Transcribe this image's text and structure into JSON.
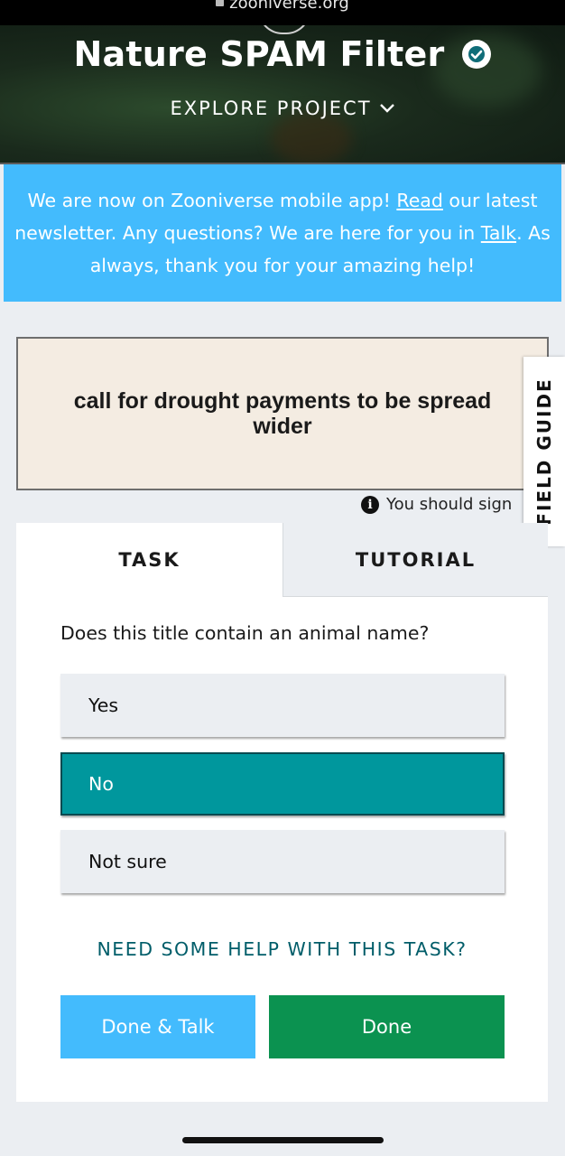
{
  "browser": {
    "url": "zooniverse.org"
  },
  "project": {
    "title": "Nature SPAM Filter",
    "explore_label": "EXPLORE PROJECT"
  },
  "banner": {
    "text_before_read": "We are now on Zooniverse mobile app! ",
    "read_link": "Read",
    "text_after_read": " our latest newsletter. Any questions? We are here for you in ",
    "talk_link": "Talk",
    "text_end": ". As always, thank you for your amazing help!"
  },
  "subject": {
    "text": "call for drought payments to be spread wider"
  },
  "notice": {
    "text": "You should sign"
  },
  "field_guide": {
    "label": "FIELD GUIDE"
  },
  "tabs": [
    {
      "label": "TASK",
      "active": true
    },
    {
      "label": "TUTORIAL",
      "active": false
    }
  ],
  "task": {
    "question": "Does this title contain an animal name?",
    "answers": [
      {
        "label": "Yes",
        "selected": false
      },
      {
        "label": "No",
        "selected": true
      },
      {
        "label": "Not sure",
        "selected": false
      }
    ],
    "help_label": "NEED SOME HELP WITH THIS TASK?"
  },
  "actions": {
    "done_talk_label": "Done & Talk",
    "done_label": "Done"
  },
  "colors": {
    "banner_bg": "#43bbfd",
    "selected_answer": "#00979d",
    "done_button": "#0b9250",
    "done_talk_button": "#43bbfd",
    "help_link": "#005d69"
  },
  "icons": [
    "lock-icon",
    "verified-check-icon",
    "chevron-down-icon",
    "info-icon"
  ]
}
